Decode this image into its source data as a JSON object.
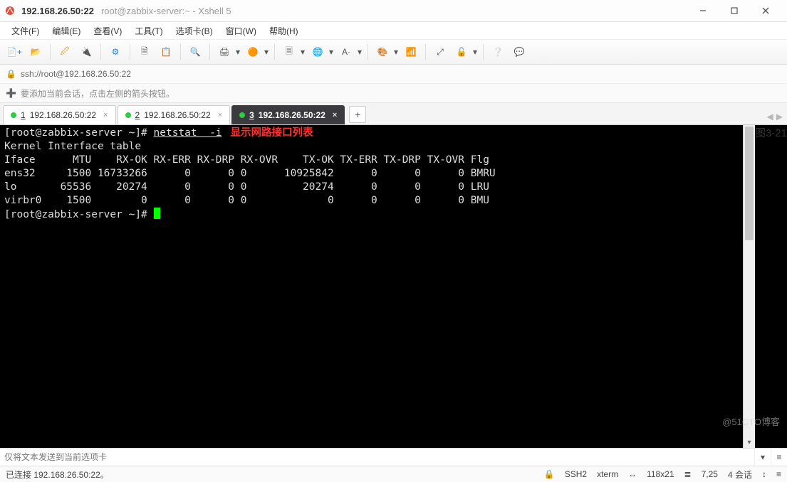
{
  "window": {
    "title_main": "192.168.26.50:22",
    "title_sub": "root@zabbix-server:~ - Xshell 5"
  },
  "menu": [
    "文件(F)",
    "编辑(E)",
    "查看(V)",
    "工具(T)",
    "选项卡(B)",
    "窗口(W)",
    "帮助(H)"
  ],
  "toolbar_icons": [
    {
      "name": "new-session-icon",
      "glyph": "📄+",
      "accent": true
    },
    {
      "name": "open-session-icon",
      "glyph": "📂"
    },
    {
      "sep": true
    },
    {
      "name": "reconnect-icon",
      "glyph": "🖉",
      "gold": true
    },
    {
      "name": "disconnect-icon",
      "glyph": "🔌",
      "gold": true
    },
    {
      "sep": true
    },
    {
      "name": "properties-icon",
      "glyph": "⚙",
      "accent": true
    },
    {
      "sep": true
    },
    {
      "name": "snippets-icon",
      "glyph": "🗎"
    },
    {
      "name": "paste-icon",
      "glyph": "📋"
    },
    {
      "sep": true
    },
    {
      "name": "find-icon",
      "glyph": "🔍"
    },
    {
      "sep": true
    },
    {
      "name": "print-icon",
      "glyph": "🖨",
      "caret": true
    },
    {
      "name": "clear-icon",
      "glyph": "🟠",
      "caret": true
    },
    {
      "sep": true
    },
    {
      "name": "encoding-icon",
      "glyph": "🗏",
      "caret": true
    },
    {
      "name": "globe-icon",
      "glyph": "🌐",
      "caret": true
    },
    {
      "name": "font-icon",
      "glyph": "A·",
      "caret": true
    },
    {
      "sep": true
    },
    {
      "name": "color-icon",
      "glyph": "🎨",
      "caret": true
    },
    {
      "name": "refresh-icon",
      "glyph": "📶"
    },
    {
      "sep": true
    },
    {
      "name": "compose-bar-icon",
      "glyph": "⤢"
    },
    {
      "name": "lock-icon",
      "glyph": "🔓",
      "caret": true
    },
    {
      "sep": true
    },
    {
      "name": "help-icon",
      "glyph": "❔"
    },
    {
      "name": "chat-icon",
      "glyph": "💬"
    }
  ],
  "addressbar": {
    "icon": "🔒",
    "text": "ssh://root@192.168.26.50:22"
  },
  "hintbar": {
    "icon": "➕",
    "text": "要添加当前会话，点击左侧的箭头按钮。"
  },
  "tabs": [
    {
      "num": "1",
      "label": "192.168.26.50:22",
      "active": false
    },
    {
      "num": "2",
      "label": "192.168.26.50:22",
      "active": false
    },
    {
      "num": "3",
      "label": "192.168.26.50:22",
      "active": true
    }
  ],
  "addtab_label": "+",
  "terminal": {
    "prompt": "[root@zabbix-server ~]# ",
    "command": "netstat  -i",
    "annotation": "显示网路接口列表",
    "header": "Kernel Interface table",
    "col_line": "Iface      MTU    RX-OK RX-ERR RX-DRP RX-OVR    TX-OK TX-ERR TX-DRP TX-OVR Flg",
    "rows": [
      "ens32     1500 16733266      0      0 0      10925842      0      0      0 BMRU",
      "lo       65536    20274      0      0 0         20274      0      0      0 LRU",
      "virbr0    1500        0      0      0 0             0      0      0      0 BMU"
    ],
    "prompt2": "[root@zabbix-server ~]# ",
    "figure_label": "图3-21"
  },
  "chart_data": {
    "type": "table",
    "title": "Kernel Interface table",
    "columns": [
      "Iface",
      "MTU",
      "RX-OK",
      "RX-ERR",
      "RX-DRP",
      "RX-OVR",
      "TX-OK",
      "TX-ERR",
      "TX-DRP",
      "TX-OVR",
      "Flg"
    ],
    "rows": [
      {
        "Iface": "ens32",
        "MTU": 1500,
        "RX-OK": 16733266,
        "RX-ERR": 0,
        "RX-DRP": 0,
        "RX-OVR": 0,
        "TX-OK": 10925842,
        "TX-ERR": 0,
        "TX-DRP": 0,
        "TX-OVR": 0,
        "Flg": "BMRU"
      },
      {
        "Iface": "lo",
        "MTU": 65536,
        "RX-OK": 20274,
        "RX-ERR": 0,
        "RX-DRP": 0,
        "RX-OVR": 0,
        "TX-OK": 20274,
        "TX-ERR": 0,
        "TX-DRP": 0,
        "TX-OVR": 0,
        "Flg": "LRU"
      },
      {
        "Iface": "virbr0",
        "MTU": 1500,
        "RX-OK": 0,
        "RX-ERR": 0,
        "RX-DRP": 0,
        "RX-OVR": 0,
        "TX-OK": 0,
        "TX-ERR": 0,
        "TX-DRP": 0,
        "TX-OVR": 0,
        "Flg": "BMU"
      }
    ]
  },
  "sendbar": {
    "placeholder": "仅将文本发送到当前选项卡"
  },
  "statusbar": {
    "conn": "已连接 192.168.26.50:22。",
    "ssh_icon": "🔒",
    "ssh": "SSH2",
    "term": "xterm",
    "size_icon": "↔",
    "size": "118x21",
    "cursor_icon": "≣",
    "cursor": "7,25",
    "sessions": "4 会话",
    "cap_icon": "↕",
    "num_icon": "≡"
  },
  "watermark": "@51CTO博客"
}
